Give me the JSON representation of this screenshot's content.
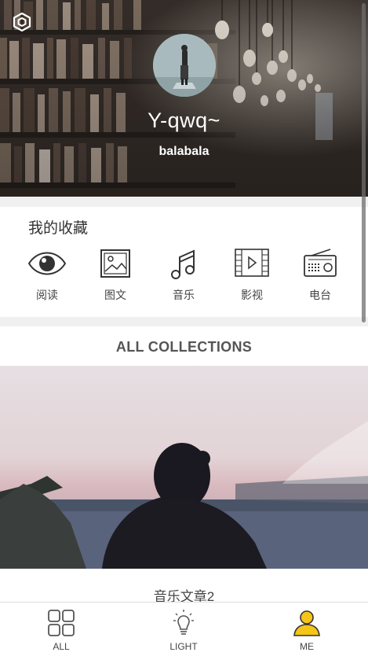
{
  "header": {
    "username": "Y-qwq~",
    "subtitle": "balabala"
  },
  "favorites": {
    "title": "我的收藏",
    "items": [
      {
        "label": "阅读",
        "icon": "eye-icon"
      },
      {
        "label": "图文",
        "icon": "image-icon"
      },
      {
        "label": "音乐",
        "icon": "music-note-icon"
      },
      {
        "label": "影视",
        "icon": "film-icon"
      },
      {
        "label": "电台",
        "icon": "radio-icon"
      }
    ]
  },
  "collections": {
    "title": "ALL COLLECTIONS",
    "article_title": "音乐文章2"
  },
  "tabbar": {
    "tabs": [
      {
        "label": "ALL",
        "icon": "grid-icon",
        "active": false
      },
      {
        "label": "LIGHT",
        "icon": "lightbulb-icon",
        "active": false
      },
      {
        "label": "ME",
        "icon": "user-icon",
        "active": true
      }
    ],
    "active_color": "#f5c518"
  }
}
